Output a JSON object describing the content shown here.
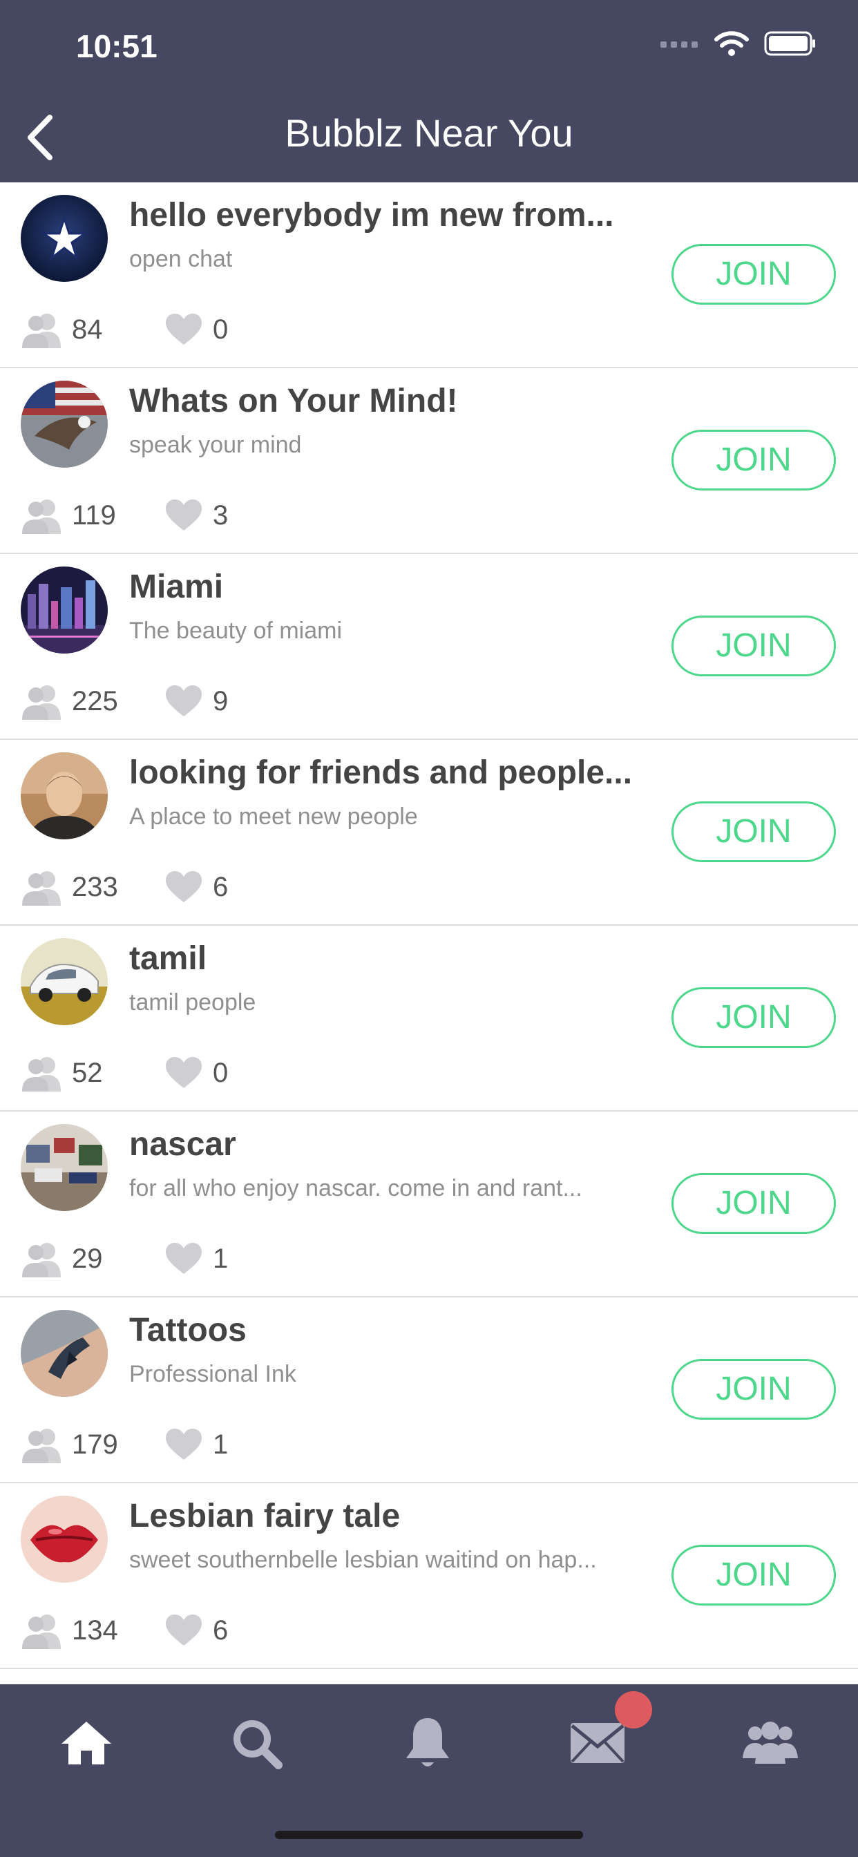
{
  "status_bar": {
    "time": "10:51"
  },
  "header": {
    "title": "Bubblz Near You"
  },
  "join_label": "JOIN",
  "rooms": [
    {
      "name": "hello everybody im new from...",
      "description": "open chat",
      "members": "84",
      "likes": "0",
      "avatar": "dallas-star-avatar"
    },
    {
      "name": "Whats on Your Mind!",
      "description": "speak your mind",
      "members": "119",
      "likes": "3",
      "avatar": "eagle-flag-avatar"
    },
    {
      "name": "Miami",
      "description": "The beauty of miami",
      "members": "225",
      "likes": "9",
      "avatar": "city-night-avatar"
    },
    {
      "name": "looking for friends and people...",
      "description": "A place to meet new people",
      "members": "233",
      "likes": "6",
      "avatar": "man-portrait-avatar"
    },
    {
      "name": "tamil",
      "description": "tamil people",
      "members": "52",
      "likes": "0",
      "avatar": "white-car-avatar"
    },
    {
      "name": "nascar",
      "description": "for all who enjoy nascar.  come in and rant...",
      "members": "29",
      "likes": "1",
      "avatar": "room-photo-avatar"
    },
    {
      "name": "Tattoos",
      "description": "Professional Ink",
      "members": "179",
      "likes": "1",
      "avatar": "tattoo-arm-avatar"
    },
    {
      "name": "Lesbian fairy tale",
      "description": "sweet southernbelle lesbian waitind on hap...",
      "members": "134",
      "likes": "6",
      "avatar": "red-lips-avatar"
    }
  ],
  "tabs": [
    {
      "icon": "home-icon"
    },
    {
      "icon": "search-icon"
    },
    {
      "icon": "bell-icon"
    },
    {
      "icon": "mail-icon"
    },
    {
      "icon": "group-icon"
    }
  ],
  "colors": {
    "header_bg": "#464862",
    "join_accent": "#4cd78a",
    "badge": "#dd5b5e"
  }
}
